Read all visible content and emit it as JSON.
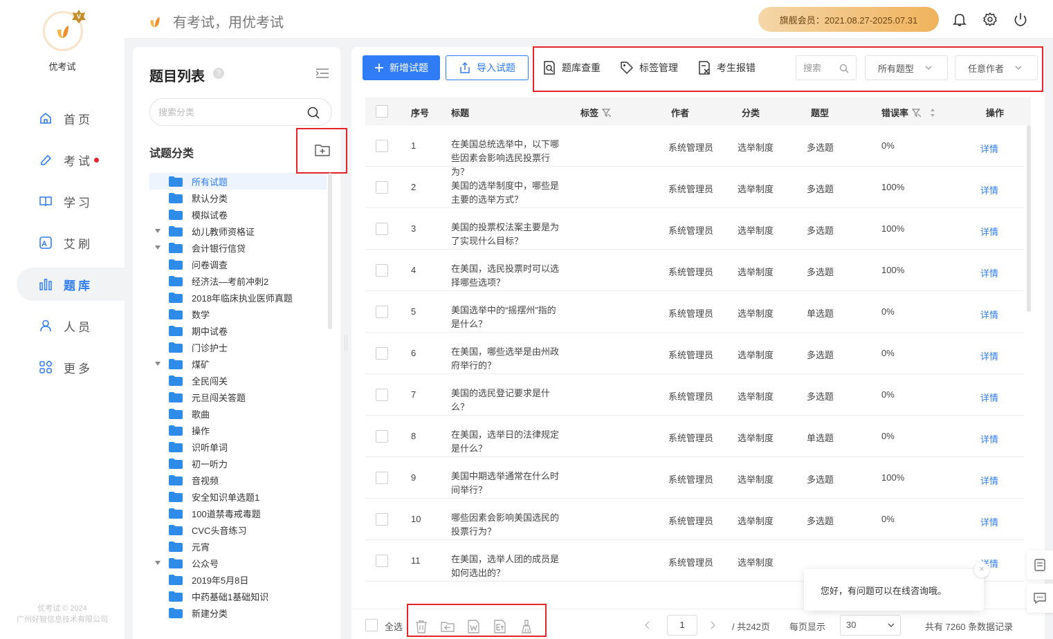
{
  "app": {
    "brand": "优考试",
    "slogan": "有考试，用优考试",
    "copyright_line1": "优考试 © 2024",
    "copyright_line2": "广州好智信息技术有限公司"
  },
  "nav": [
    {
      "label": "首页",
      "icon": "home-icon",
      "active": false
    },
    {
      "label": "考试",
      "icon": "exam-icon",
      "active": false,
      "dot": true
    },
    {
      "label": "学习",
      "icon": "book-icon",
      "active": false
    },
    {
      "label": "艾刷",
      "icon": "practice-icon",
      "active": false
    },
    {
      "label": "题库",
      "icon": "question-bank-icon",
      "active": true
    },
    {
      "label": "人员",
      "icon": "user-icon",
      "active": false
    },
    {
      "label": "更多",
      "icon": "more-icon",
      "active": false
    }
  ],
  "topbar": {
    "member": "旗舰会员：2021.08.27-2025.07.31"
  },
  "catpanel": {
    "title": "题目列表",
    "help": "?",
    "search_placeholder": "搜索分类",
    "sub_title": "试题分类",
    "items": [
      {
        "label": "所有试题",
        "selected": true,
        "arrow": false
      },
      {
        "label": "默认分类",
        "arrow": false
      },
      {
        "label": "模拟试卷",
        "arrow": false
      },
      {
        "label": "幼儿教师资格证",
        "arrow": true
      },
      {
        "label": "会计银行信贷",
        "arrow": true
      },
      {
        "label": "问卷调查",
        "arrow": false
      },
      {
        "label": "经济法—考前冲刺2",
        "arrow": false
      },
      {
        "label": "2018年临床执业医师真题",
        "arrow": false
      },
      {
        "label": "数学",
        "arrow": false
      },
      {
        "label": "期中试卷",
        "arrow": false
      },
      {
        "label": "门诊护士",
        "arrow": false
      },
      {
        "label": "煤矿",
        "arrow": true
      },
      {
        "label": "全民闯关",
        "arrow": false
      },
      {
        "label": "元旦闯关答题",
        "arrow": false
      },
      {
        "label": "歌曲",
        "arrow": false
      },
      {
        "label": "操作",
        "arrow": false
      },
      {
        "label": "识听单词",
        "arrow": false
      },
      {
        "label": "初一听力",
        "arrow": false
      },
      {
        "label": "音视频",
        "arrow": false
      },
      {
        "label": "安全知识单选题1",
        "arrow": false
      },
      {
        "label": "100道禁毒戒毒题",
        "arrow": false
      },
      {
        "label": "CVC头音练习",
        "arrow": false
      },
      {
        "label": "元宵",
        "arrow": false
      },
      {
        "label": "公众号",
        "arrow": true
      },
      {
        "label": "2019年5月8日",
        "arrow": false
      },
      {
        "label": "中药基础1基础知识",
        "arrow": false
      },
      {
        "label": "新建分类",
        "arrow": false
      }
    ]
  },
  "toolbar": {
    "add_label": "新增试题",
    "import_label": "导入试题",
    "dedupe_label": "题库查重",
    "tag_label": "标签管理",
    "report_label": "考生报错",
    "search_placeholder": "搜索",
    "type_filter": "所有题型",
    "author_filter": "任意作者"
  },
  "table": {
    "headers": {
      "index": "序号",
      "title": "标题",
      "tags": "标签",
      "author": "作者",
      "category": "分类",
      "type": "题型",
      "error_rate": "错误率",
      "action": "操作"
    },
    "rows": [
      {
        "index": "1",
        "title": "在美国总统选举中，以下哪些因素会影响选民投票行为？",
        "author": "系统管理员",
        "category": "选举制度",
        "type": "多选题",
        "error_rate": "0%",
        "action": "详情"
      },
      {
        "index": "2",
        "title": "美国的选举制度中，哪些是主要的选举方式？",
        "author": "系统管理员",
        "category": "选举制度",
        "type": "多选题",
        "error_rate": "100%",
        "action": "详情"
      },
      {
        "index": "3",
        "title": "美国的投票权法案主要是为了实现什么目标？",
        "author": "系统管理员",
        "category": "选举制度",
        "type": "多选题",
        "error_rate": "100%",
        "action": "详情"
      },
      {
        "index": "4",
        "title": "在美国，选民投票时可以选择哪些选项？",
        "author": "系统管理员",
        "category": "选举制度",
        "type": "多选题",
        "error_rate": "100%",
        "action": "详情"
      },
      {
        "index": "5",
        "title": "美国选举中的“摇摆州”指的是什么？",
        "author": "系统管理员",
        "category": "选举制度",
        "type": "单选题",
        "error_rate": "0%",
        "action": "详情"
      },
      {
        "index": "6",
        "title": "在美国，哪些选举是由州政府举行的？",
        "author": "系统管理员",
        "category": "选举制度",
        "type": "多选题",
        "error_rate": "0%",
        "action": "详情"
      },
      {
        "index": "7",
        "title": "美国的选民登记要求是什么？",
        "author": "系统管理员",
        "category": "选举制度",
        "type": "多选题",
        "error_rate": "0%",
        "action": "详情"
      },
      {
        "index": "8",
        "title": "在美国，选举日的法律规定是什么？",
        "author": "系统管理员",
        "category": "选举制度",
        "type": "单选题",
        "error_rate": "0%",
        "action": "详情"
      },
      {
        "index": "9",
        "title": "美国中期选举通常在什么时间举行？",
        "author": "系统管理员",
        "category": "选举制度",
        "type": "多选题",
        "error_rate": "100%",
        "action": "详情"
      },
      {
        "index": "10",
        "title": "哪些因素会影响美国选民的投票行为？",
        "author": "系统管理员",
        "category": "选举制度",
        "type": "多选题",
        "error_rate": "0%",
        "action": "详情"
      },
      {
        "index": "11",
        "title": "在美国，选举人团的成员是如何选出的？",
        "author": "系统管理员",
        "category": "选举制度",
        "type": "",
        "error_rate": "",
        "action": "详情"
      }
    ]
  },
  "footer": {
    "select_all": "全选",
    "page": "1",
    "total_pages": "/ 共242页",
    "per_page_label": "每页显示",
    "per_page": "30",
    "total": "共有 7260 条数据记录"
  },
  "chat": {
    "message": "您好，有问题可以在线咨询哦。",
    "close": "×"
  },
  "colors": {
    "accent": "#2f7cf6",
    "highlight_box": "#e3242b",
    "member_gold": "#f0b35c"
  }
}
